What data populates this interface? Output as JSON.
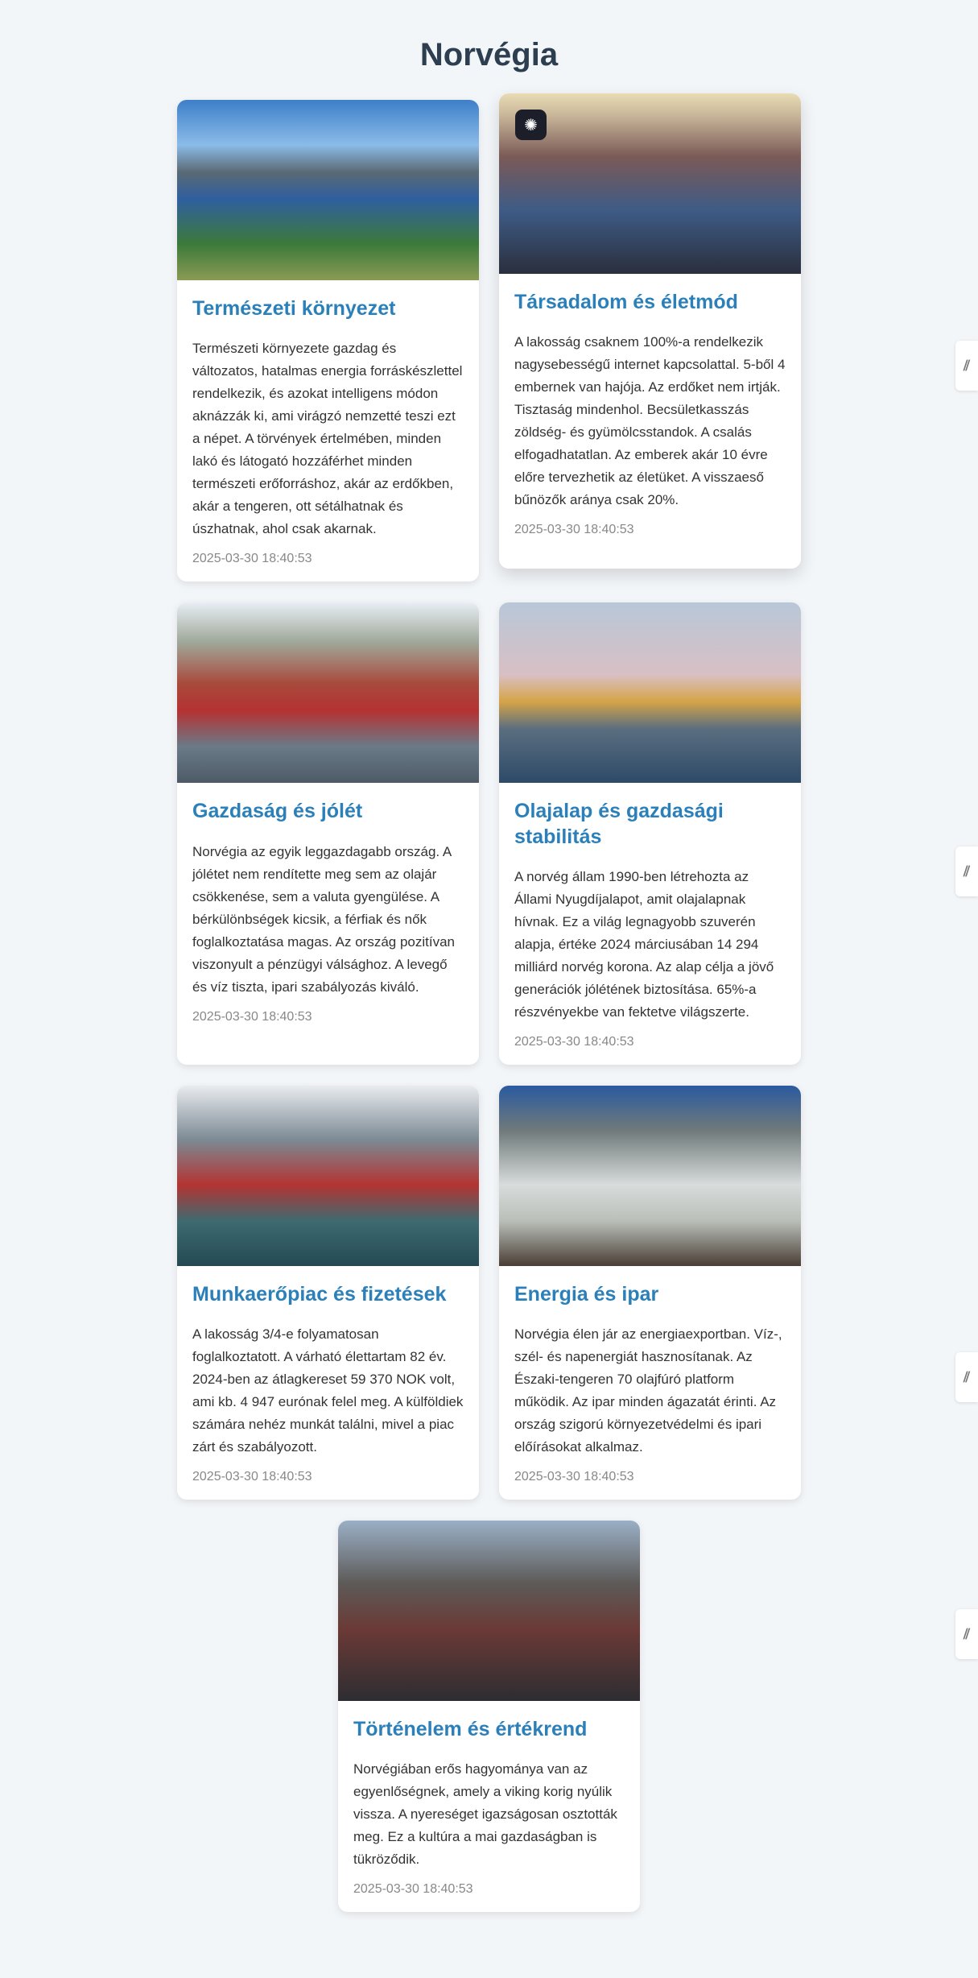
{
  "page": {
    "title": "Norvégia"
  },
  "cards": [
    {
      "title": "Természeti környezet",
      "text": "Természeti környezete gazdag és változatos, hatalmas energia forráskészlettel rendelkezik, és azokat intelligens módon aknázzák ki, ami virágzó nemzetté teszi ezt a népet. A törvények értelmében, minden lakó és látogató hozzáférhet minden természeti erőforráshoz, akár az erdőkben, akár a tengeren, ott sétálhatnak és úszhatnak, ahol csak akarnak.",
      "date": "2025-03-30 18:40:53"
    },
    {
      "title": "Társadalom és életmód",
      "text": "A lakosság csaknem 100%-a rendelkezik nagysebességű internet kapcsolattal. 5-ből 4 embernek van hajója. Az erdőket nem irtják. Tisztaság mindenhol. Becsületkasszás zöldség- és gyümölcsstandok. A csalás elfogadhatatlan. Az emberek akár 10 évre előre tervezhetik az életüket. A visszaeső bűnözők aránya csak 20%.",
      "date": "2025-03-30 18:40:53"
    },
    {
      "title": "Gazdaság és jólét",
      "text": "Norvégia az egyik leggazdagabb ország. A jólétet nem rendítette meg sem az olajár csökkenése, sem a valuta gyengülése. A bérkülönbségek kicsik, a férfiak és nők foglalkoztatása magas. Az ország pozitívan viszonyult a pénzügyi válsághoz. A levegő és víz tiszta, ipari szabályozás kiváló.",
      "date": "2025-03-30 18:40:53"
    },
    {
      "title": "Olajalap és gazdasági stabilitás",
      "text": "A norvég állam 1990-ben létrehozta az Állami Nyugdíjalapot, amit olajalapnak hívnak. Ez a világ legnagyobb szuverén alapja, értéke 2024 márciusában 14 294 milliárd norvég korona. Az alap célja a jövő generációk jólétének biztosítása. 65%-a részvényekbe van fektetve világszerte.",
      "date": "2025-03-30 18:40:53"
    },
    {
      "title": "Munkaerőpiac és fizetések",
      "text": "A lakosság 3/4-e folyamatosan foglalkoztatott. A várható élettartam 82 év. 2024-ben az átlagkereset 59 370 NOK volt, ami kb. 4 947 eurónak felel meg. A külföldiek számára nehéz munkát találni, mivel a piac zárt és szabályozott.",
      "date": "2025-03-30 18:40:53"
    },
    {
      "title": "Energia és ipar",
      "text": "Norvégia élen jár az energiaexportban. Víz-, szél- és napenergiát hasznosítanak. Az Északi-tengeren 70 olajfúró platform működik. Az ipar minden ágazatát érinti. Az ország szigorú környezetvédelmi és ipari előírásokat alkalmaz.",
      "date": "2025-03-30 18:40:53"
    },
    {
      "title": "Történelem és értékrend",
      "text": "Norvégiában erős hagyománya van az egyenlőségnek, amely a viking korig nyúlik vissza. A nyereséget igazságosan osztották meg. Ez a kultúra a mai gazdaságban is tükröződik.",
      "date": "2025-03-30 18:40:53"
    }
  ],
  "colors": {
    "accent": "#2b80b9",
    "heading": "#2c3e50",
    "background": "#f3f6f9"
  },
  "icons": {
    "badge": "brain-icon",
    "side": "translate-icon"
  }
}
